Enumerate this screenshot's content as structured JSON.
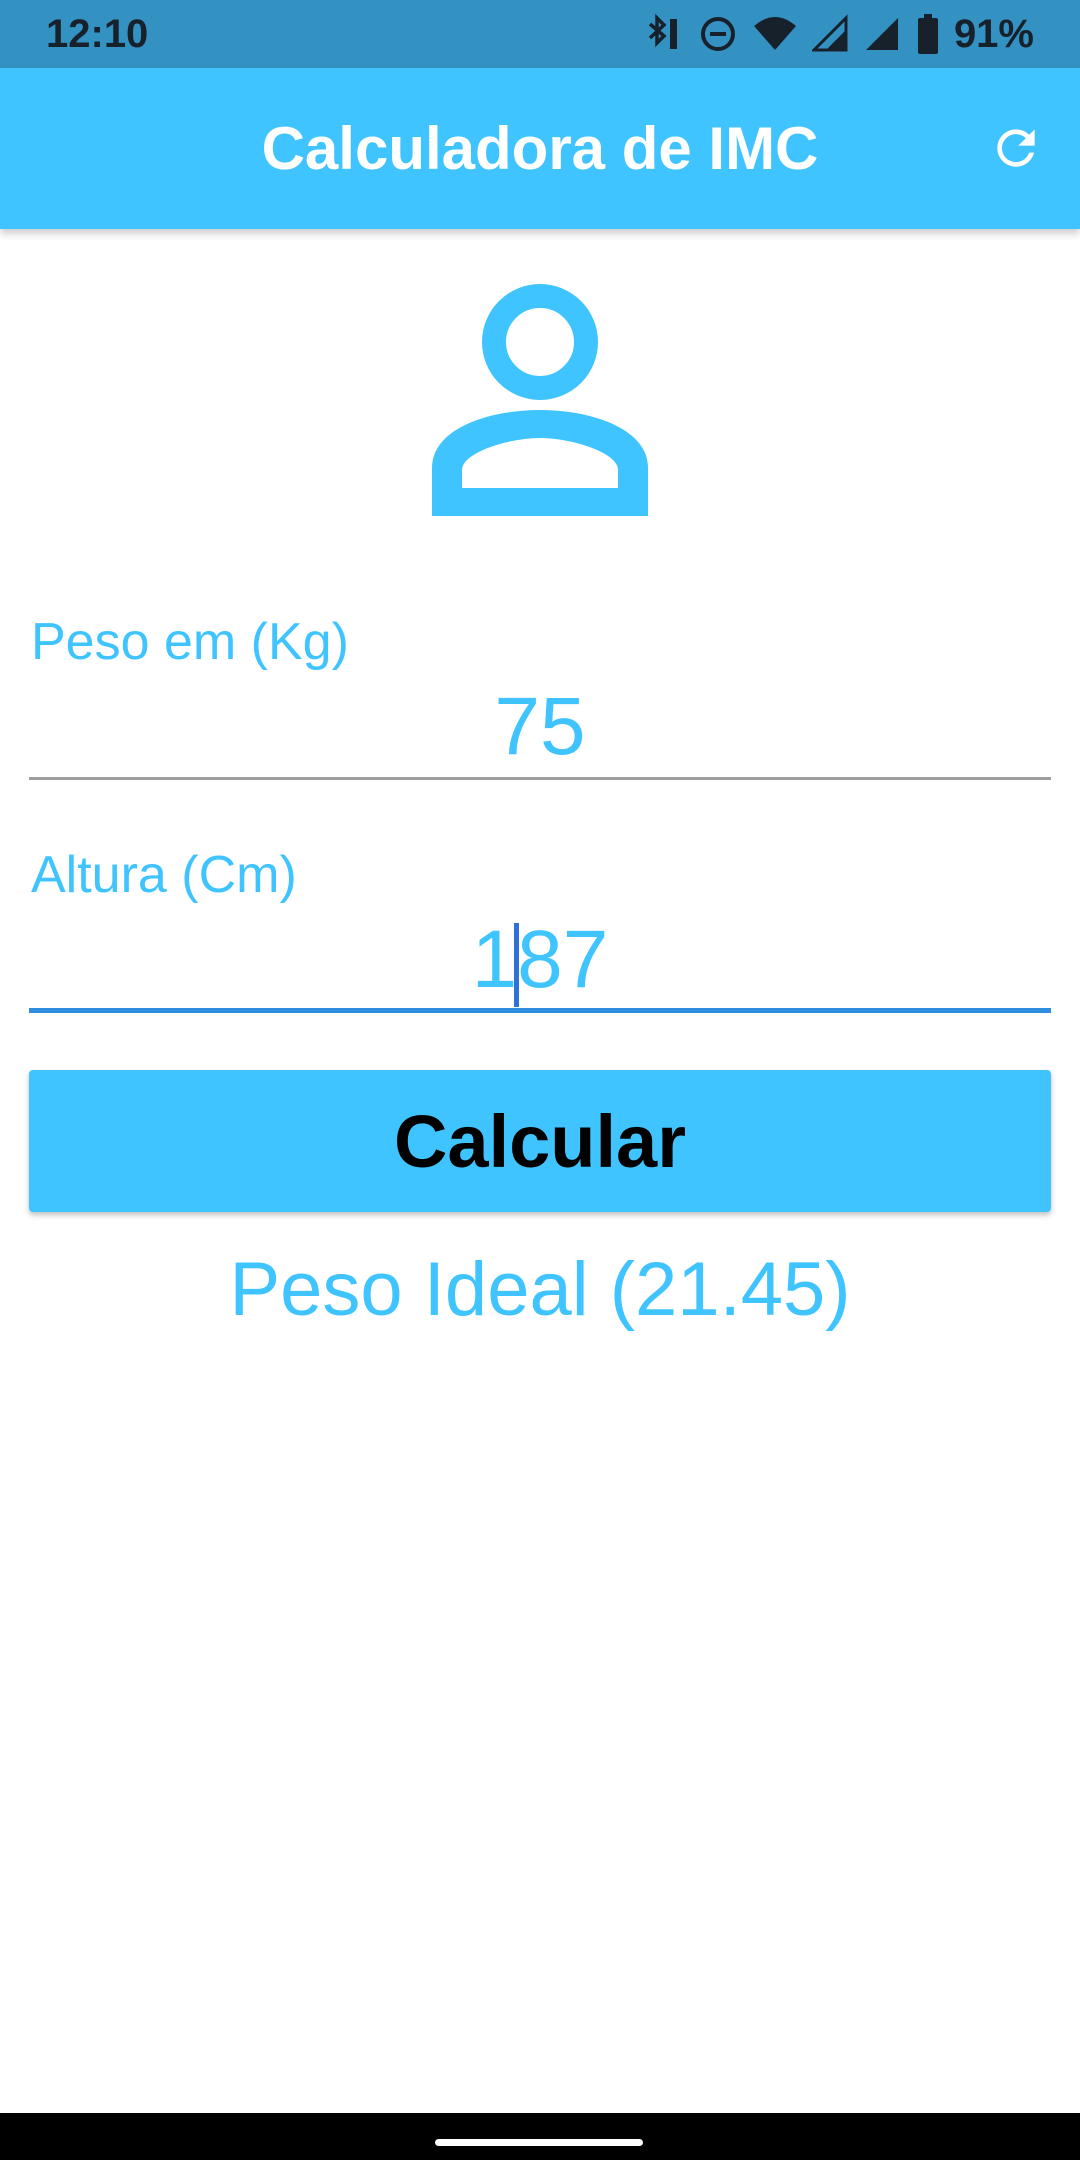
{
  "status_bar": {
    "time": "12:10",
    "battery_percent": "91%",
    "icons": [
      "bluetooth-icon",
      "do-not-disturb-icon",
      "wifi-icon",
      "signal-icon",
      "signal-icon",
      "battery-icon"
    ],
    "color": "#3492c3"
  },
  "app_bar": {
    "title": "Calculadora de IMC",
    "action_icon": "refresh-icon",
    "color": "#40c4ff"
  },
  "form": {
    "avatar_icon": "person-outline-icon",
    "weight": {
      "label": "Peso em (Kg)",
      "value": "75"
    },
    "height": {
      "label": "Altura (Cm)",
      "value": "187"
    },
    "calculate_label": "Calcular"
  },
  "result": {
    "text": "Peso Ideal (21.45)"
  },
  "colors": {
    "accent": "#40c4ff",
    "focus_line": "#2f8de0",
    "text_dark": "#000000"
  }
}
